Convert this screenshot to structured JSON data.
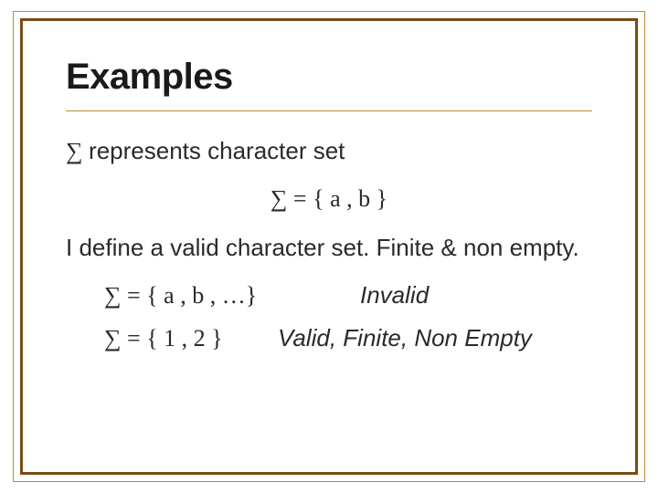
{
  "title": "Examples",
  "line1_prefix": "∑ ",
  "line1_rest": "represents character set",
  "line2": "∑ = { a , b }",
  "line3": "I define a valid character set. Finite & non empty.",
  "ex1_expr": "∑ = { a , b , …}",
  "ex1_note": "Invalid",
  "ex2_expr": "∑ = { 1 , 2 }",
  "ex2_note": "Valid, Finite, Non Empty"
}
